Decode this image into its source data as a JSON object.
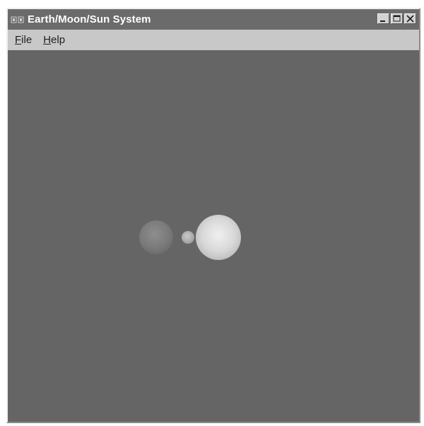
{
  "window": {
    "title": "Earth/Moon/Sun System"
  },
  "titlebar": {
    "icon": "app-window-icon",
    "buttons": [
      {
        "name": "minimize",
        "icon": "minimize-icon"
      },
      {
        "name": "maximize",
        "icon": "maximize-icon"
      },
      {
        "name": "close",
        "icon": "close-icon"
      }
    ]
  },
  "menubar": {
    "items": [
      {
        "label_access": "F",
        "label_rest": "ile"
      },
      {
        "label_access": "H",
        "label_rest": "elp"
      }
    ]
  },
  "scene": {
    "background_color": "#656565",
    "bodies": [
      {
        "name": "earth",
        "shade": "#8a8a8a"
      },
      {
        "name": "moon",
        "shade": "#b5b5b5"
      },
      {
        "name": "sun",
        "shade": "#d9d9d9"
      }
    ]
  }
}
